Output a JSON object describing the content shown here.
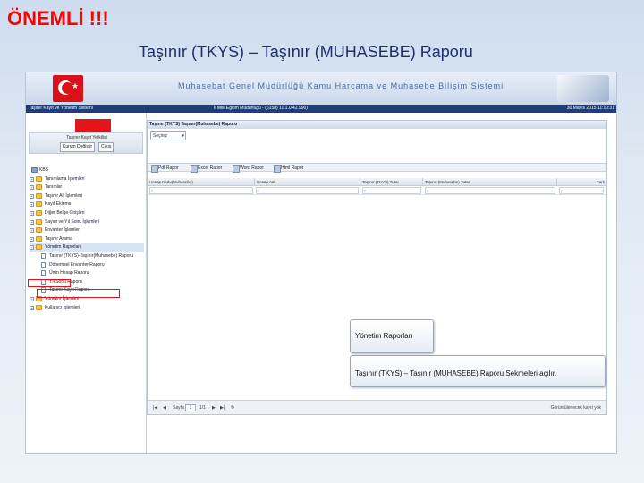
{
  "slide": {
    "title": "ÖNEMLİ !!!",
    "subtitle": "Taşınır (TKYS) – Taşınır (MUHASEBE) Raporu"
  },
  "app": {
    "banner_title": "Muhasebat Genel Müdürlüğü Kamu Harcama ve Muhasebe Bilişim Sistemi",
    "status_left": "Taşınır Kayıt ve Yönetim Sistemi",
    "status_center": "İl Milli Eğitim Müdürlüğü - (6158) 11.1.0.42.990)",
    "status_right": "30 Mayıs 2015 11:10:31",
    "left_panel": {
      "title": "Taşınır Kayıt Yetkilisi",
      "role_button": "Kurum Değiştir",
      "exit_button": "Çıkış"
    },
    "tree": [
      {
        "type": "root",
        "label": "KBS"
      },
      {
        "type": "folder",
        "label": "Tanımlama İşlemleri"
      },
      {
        "type": "folder",
        "label": "Tanımlar"
      },
      {
        "type": "folder",
        "label": "Taşınır Alt İşlemleri"
      },
      {
        "type": "folder",
        "label": "Kayıt Ekleme"
      },
      {
        "type": "folder",
        "label": "Diğer Belge Girişleri"
      },
      {
        "type": "folder",
        "label": "Sayım ve Yıl Sonu İşlemleri"
      },
      {
        "type": "folder",
        "label": "Envanter İşlemler"
      },
      {
        "type": "folder",
        "label": "Taşınır Arama"
      },
      {
        "type": "folder",
        "label": "Yönetim Raporları"
      },
      {
        "type": "doc",
        "label": "Taşınır (TKYS)-Taşınır(Muhasebe) Raporu"
      },
      {
        "type": "doc",
        "label": "Dönemsel Envanter Raporu"
      },
      {
        "type": "doc",
        "label": "Ürün Hesap Raporu"
      },
      {
        "type": "doc",
        "label": "Yıl Sonu Raporu"
      },
      {
        "type": "doc",
        "label": "Taşınır Kayıt Raporu"
      },
      {
        "type": "folder",
        "label": "Yönetim İşlemleri"
      },
      {
        "type": "folder",
        "label": "Kullanıcı İşlemleri"
      }
    ],
    "report": {
      "title": "Taşınır (TKYS) Taşınır(Muhasebe) Raporu",
      "select_value": "Seçiniz",
      "tabs": [
        "Pdf Rapor",
        "Excel Rapor",
        "Word Rapor",
        "Html Rapor"
      ],
      "columns": [
        "Hesap Kodu(Muhasebe)",
        "Hesap Adı",
        "Taşınır (TKYS) Tutar",
        "Taşınır (Muhasebe) Tutar",
        "Fark"
      ],
      "pager_page_label": "Sayfa",
      "pager_page_value": "1",
      "pager_total": "1/1",
      "pager_summary": "Görüntülenecek kayıt yok"
    }
  },
  "callouts": {
    "first": "Yönetim Raporları",
    "second": "Taşınır (TKYS) – Taşınır (MUHASEBE) Raporu Sekmeleri açılır."
  }
}
